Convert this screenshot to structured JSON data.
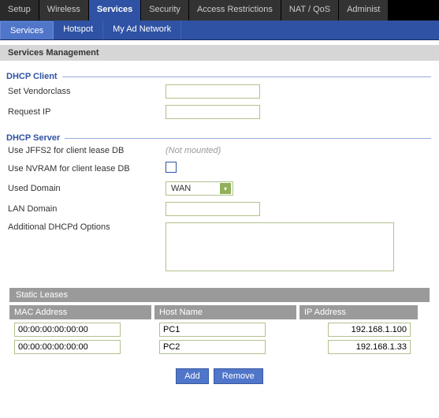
{
  "topnav": {
    "tabs": [
      "Setup",
      "Wireless",
      "Services",
      "Security",
      "Access Restrictions",
      "NAT / QoS",
      "Administ"
    ],
    "active": 2
  },
  "subnav": {
    "tabs": [
      "Services",
      "Hotspot",
      "My Ad Network"
    ],
    "active": 0
  },
  "page_title": "Services Management",
  "dhcp_client": {
    "legend": "DHCP Client",
    "vendorclass_label": "Set Vendorclass",
    "vendorclass_value": "",
    "requestip_label": "Request IP",
    "requestip_value": ""
  },
  "dhcp_server": {
    "legend": "DHCP Server",
    "jffs2_label": "Use JFFS2 for client lease DB",
    "jffs2_value": "(Not mounted)",
    "nvram_label": "Use NVRAM for client lease DB",
    "nvram_checked": false,
    "used_domain_label": "Used Domain",
    "used_domain_value": "WAN",
    "lan_domain_label": "LAN Domain",
    "lan_domain_value": "",
    "addopts_label": "Additional DHCPd Options",
    "addopts_value": ""
  },
  "leases": {
    "title": "Static Leases",
    "cols": {
      "mac": "MAC Address",
      "host": "Host Name",
      "ip": "IP Address"
    },
    "rows": [
      {
        "mac": "00:00:00:00:00:00",
        "host": "PC1",
        "ip": "192.168.1.100"
      },
      {
        "mac": "00:00:00:00:00:00",
        "host": "PC2",
        "ip": "192.168.1.33"
      }
    ],
    "add_label": "Add",
    "remove_label": "Remove"
  }
}
